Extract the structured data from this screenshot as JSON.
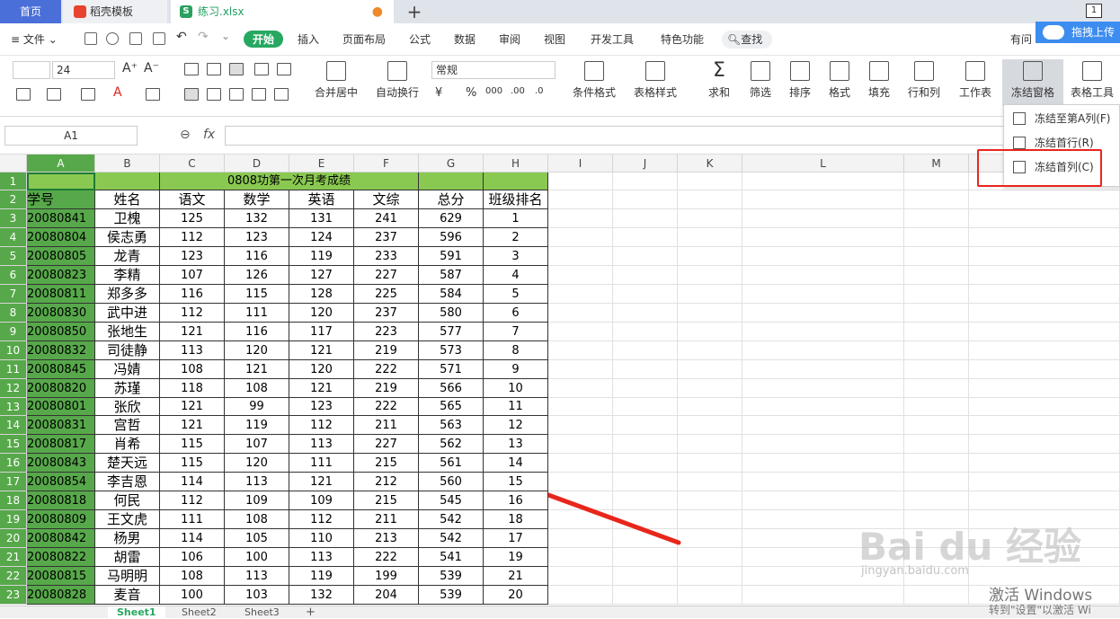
{
  "tabs": {
    "home": "首页",
    "template": "稻壳模板",
    "file": "练习.xlsx",
    "add": "+"
  },
  "window_badge": "1",
  "menu": {
    "file": "文件",
    "start": "开始",
    "items": [
      "插入",
      "页面布局",
      "公式",
      "数据",
      "审阅",
      "视图",
      "开发工具",
      "特色功能"
    ],
    "search": "查找",
    "right": "有问",
    "cloud_upload": "拖拽上传"
  },
  "ribbon": {
    "font_size": "24",
    "number_format": "常规",
    "merge_center": "合并居中",
    "wrap_text": "自动换行",
    "conditional_format": "条件格式",
    "table_style": "表格样式",
    "sum": "求和",
    "filter": "筛选",
    "sort": "排序",
    "format": "格式",
    "fill": "填充",
    "row_col": "行和列",
    "worksheet": "工作表",
    "freeze_panes": "冻结窗格",
    "table_tools": "表格工具"
  },
  "freeze_menu": {
    "item1": "冻结至第A列(F)",
    "item2": "冻结首行(R)",
    "item3": "冻结首列(C)"
  },
  "formula_bar": {
    "cell_ref": "A1",
    "fx": "fx"
  },
  "columns": [
    "A",
    "B",
    "C",
    "D",
    "E",
    "F",
    "G",
    "H",
    "I",
    "J",
    "K",
    "L",
    "M",
    "N"
  ],
  "sheet": {
    "title": "0808功第一次月考成绩",
    "headers": [
      "学号",
      "姓名",
      "语文",
      "数学",
      "英语",
      "文综",
      "总分",
      "班级排名"
    ],
    "rows": [
      [
        "20080841",
        "卫槐",
        "125",
        "132",
        "131",
        "241",
        "629",
        "1"
      ],
      [
        "20080804",
        "侯志勇",
        "112",
        "123",
        "124",
        "237",
        "596",
        "2"
      ],
      [
        "20080805",
        "龙青",
        "123",
        "116",
        "119",
        "233",
        "591",
        "3"
      ],
      [
        "20080823",
        "李精",
        "107",
        "126",
        "127",
        "227",
        "587",
        "4"
      ],
      [
        "20080811",
        "郑多多",
        "116",
        "115",
        "128",
        "225",
        "584",
        "5"
      ],
      [
        "20080830",
        "武中进",
        "112",
        "111",
        "120",
        "237",
        "580",
        "6"
      ],
      [
        "20080850",
        "张地生",
        "121",
        "116",
        "117",
        "223",
        "577",
        "7"
      ],
      [
        "20080832",
        "司徒静",
        "113",
        "120",
        "121",
        "219",
        "573",
        "8"
      ],
      [
        "20080845",
        "冯婧",
        "108",
        "121",
        "120",
        "222",
        "571",
        "9"
      ],
      [
        "20080820",
        "苏瑾",
        "118",
        "108",
        "121",
        "219",
        "566",
        "10"
      ],
      [
        "20080801",
        "张欣",
        "121",
        "99",
        "123",
        "222",
        "565",
        "11"
      ],
      [
        "20080831",
        "宫哲",
        "121",
        "119",
        "112",
        "211",
        "563",
        "12"
      ],
      [
        "20080817",
        "肖希",
        "115",
        "107",
        "113",
        "227",
        "562",
        "13"
      ],
      [
        "20080843",
        "楚天远",
        "115",
        "120",
        "111",
        "215",
        "561",
        "14"
      ],
      [
        "20080854",
        "李吉恩",
        "114",
        "113",
        "121",
        "212",
        "560",
        "15"
      ],
      [
        "20080818",
        "何民",
        "112",
        "109",
        "109",
        "215",
        "545",
        "16"
      ],
      [
        "20080809",
        "王文虎",
        "111",
        "108",
        "112",
        "211",
        "542",
        "18"
      ],
      [
        "20080842",
        "杨男",
        "114",
        "105",
        "110",
        "213",
        "542",
        "17"
      ],
      [
        "20080822",
        "胡雷",
        "106",
        "100",
        "113",
        "222",
        "541",
        "19"
      ],
      [
        "20080815",
        "马明明",
        "108",
        "113",
        "119",
        "199",
        "539",
        "21"
      ],
      [
        "20080828",
        "麦音",
        "100",
        "103",
        "132",
        "204",
        "539",
        "20"
      ]
    ]
  },
  "sheet_tabs": [
    "Sheet1",
    "Sheet2",
    "Sheet3"
  ],
  "watermark": {
    "brand": "Bai du 经验",
    "url": "jingyan.baidu.com",
    "activate_title": "激活 Windows",
    "activate_sub": "转到\"设置\"以激活 Wi"
  },
  "colors": {
    "accent_green": "#27a861",
    "header_green": "#8ac951",
    "column_a_green": "#57a84a",
    "highlight_red": "#e8261c",
    "home_tab_blue": "#4a6fd8"
  }
}
